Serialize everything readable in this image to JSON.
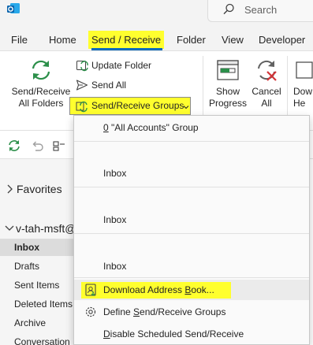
{
  "search": {
    "placeholder": "Search"
  },
  "tabs": [
    {
      "label": "File"
    },
    {
      "label": "Home"
    },
    {
      "label": "Send / Receive"
    },
    {
      "label": "Folder"
    },
    {
      "label": "View"
    },
    {
      "label": "Developer"
    }
  ],
  "ribbon": {
    "send_receive_all": {
      "line1": "Send/Receive",
      "line2": "All Folders"
    },
    "update_folder": "Update Folder",
    "send_all": "Send All",
    "send_receive_groups": "Send/Receive Groups",
    "show_progress": {
      "line1": "Show",
      "line2": "Progress"
    },
    "cancel_all": {
      "line1": "Cancel",
      "line2": "All"
    },
    "download_partial": {
      "line1": "Dow",
      "line2": "He"
    }
  },
  "folders": {
    "favorites": "Favorites",
    "account": "v-tah-msft@",
    "items": [
      {
        "label": "Inbox",
        "selected": true
      },
      {
        "label": "Drafts"
      },
      {
        "label": "Sent Items"
      },
      {
        "label": "Deleted Items"
      },
      {
        "label": "Archive"
      },
      {
        "label": "Conversation"
      }
    ]
  },
  "menu": {
    "all_accounts_group": {
      "prefix": "0",
      "rest": " \"All Accounts\" Group"
    },
    "inbox_entries": [
      "Inbox",
      "Inbox",
      "Inbox"
    ],
    "download_address_book": {
      "pre": "Download Address ",
      "acc": "B",
      "post": "ook..."
    },
    "define_groups": {
      "pre": "Define ",
      "acc": "S",
      "post": "end/Receive Groups"
    },
    "disable_scheduled": {
      "acc": "D",
      "post": "isable Scheduled Send/Receive"
    }
  },
  "colors": {
    "highlight": "#ffff2e",
    "accent": "#0f6cbd",
    "sync_green": "#2c8f4a",
    "cancel_red": "#d13438"
  }
}
